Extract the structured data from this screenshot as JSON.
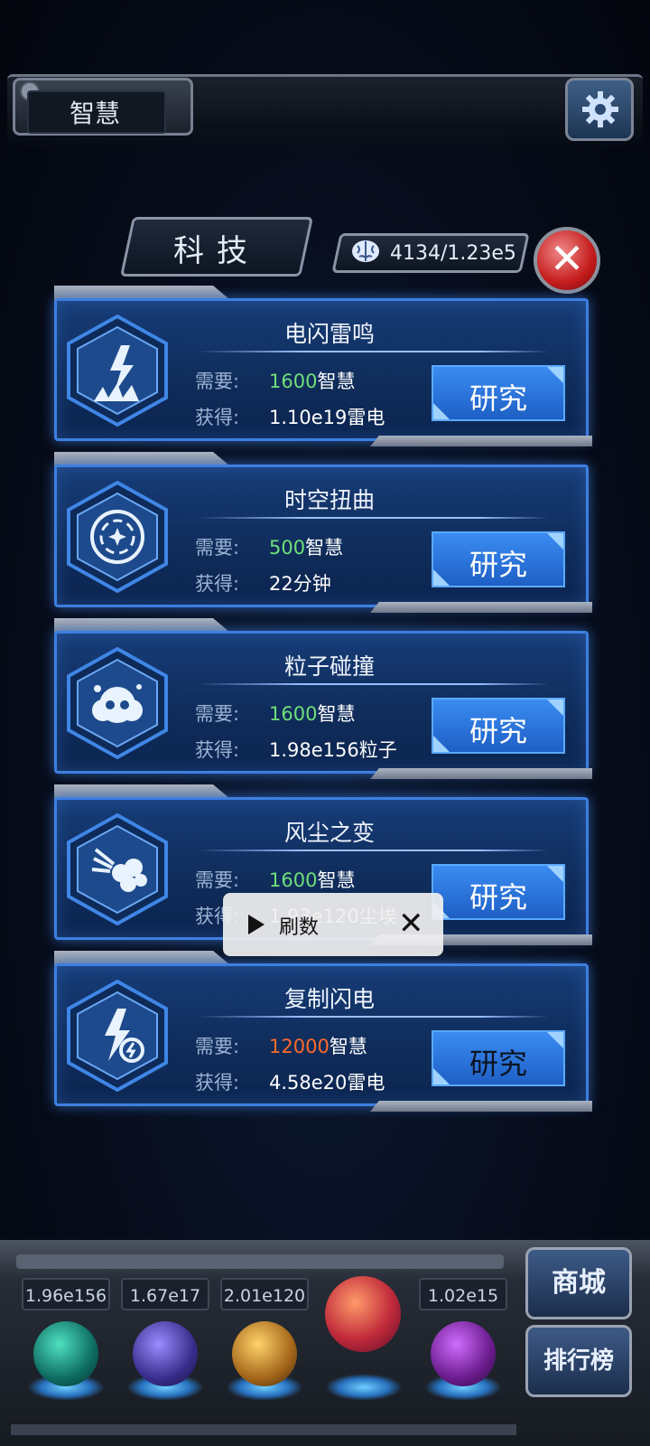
{
  "header": {
    "resource_tab": "智慧"
  },
  "panel": {
    "title": "科技",
    "wisdom_count": "4134/1.23e5"
  },
  "labels": {
    "need": "需要:",
    "gain": "获得:",
    "research": "研究"
  },
  "cards": [
    {
      "title": "电闪雷鸣",
      "need_num": "1600",
      "need_unit": "智慧",
      "gain": "1.10e19雷电",
      "need_color": "green"
    },
    {
      "title": "时空扭曲",
      "need_num": "500",
      "need_unit": "智慧",
      "gain": "22分钟",
      "need_color": "green"
    },
    {
      "title": "粒子碰撞",
      "need_num": "1600",
      "need_unit": "智慧",
      "gain": "1.98e156粒子",
      "need_color": "green"
    },
    {
      "title": "风尘之变",
      "need_num": "1600",
      "need_unit": "智慧",
      "gain": "1.93e120尘埃",
      "need_color": "green"
    },
    {
      "title": "复制闪电",
      "need_num": "12000",
      "need_unit": "智慧",
      "gain": "4.58e20雷电",
      "need_color": "red"
    }
  ],
  "toast": {
    "label": "刷数"
  },
  "bottom": {
    "resources": [
      "1.96e156",
      "1.67e17",
      "2.01e120",
      "",
      "1.02e15"
    ],
    "shop": "商城",
    "ranking": "排行榜"
  }
}
